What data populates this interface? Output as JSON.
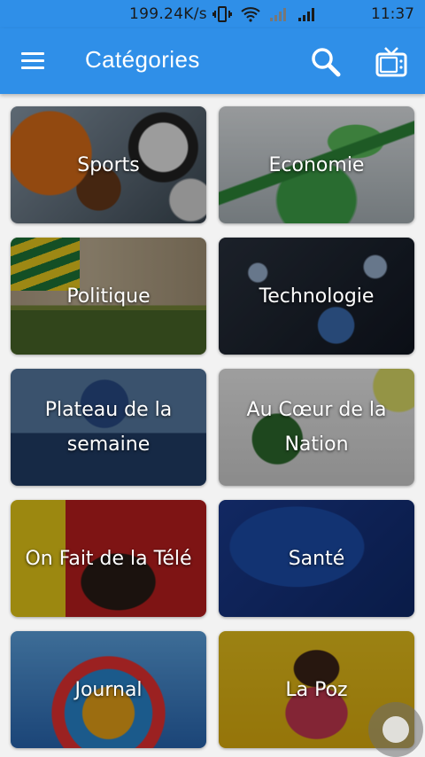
{
  "status_bar": {
    "network_speed": "199.24K/s",
    "time": "11:37",
    "icons": [
      "vibrate-icon",
      "wifi-icon",
      "signal-icon",
      "signal-icon"
    ]
  },
  "app_bar": {
    "title": "Catégories",
    "menu_icon": "hamburger-menu-icon",
    "search_icon": "search-icon",
    "tv_icon": "tv-icon",
    "color": "#2f8fe8"
  },
  "categories": [
    {
      "label": "Sports",
      "icon": "sports-image"
    },
    {
      "label": "Economie",
      "icon": "economie-image"
    },
    {
      "label": "Politique",
      "icon": "politique-image"
    },
    {
      "label": "Technologie",
      "icon": "technologie-image"
    },
    {
      "label": "Plateau de la semaine",
      "icon": "plateau-image"
    },
    {
      "label": "Au Cœur de la Nation",
      "icon": "coeur-nation-image"
    },
    {
      "label": "On Fait de la Télé",
      "icon": "tele-image"
    },
    {
      "label": "Santé",
      "icon": "sante-image"
    },
    {
      "label": "Journal",
      "icon": "journal-image"
    },
    {
      "label": "La Poz",
      "icon": "lapoz-image"
    }
  ]
}
